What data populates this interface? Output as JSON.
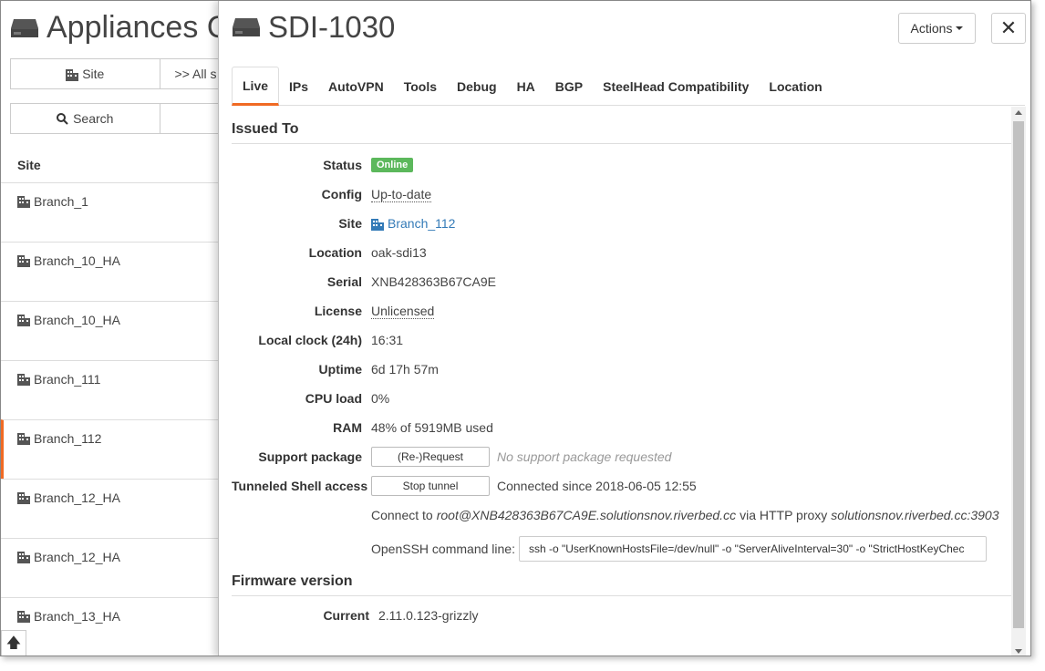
{
  "background": {
    "title": "Appliances C",
    "filter": {
      "site_button": "Site",
      "all_sites": ">> All s"
    },
    "search_button": "Search",
    "column_header": "Site",
    "sites": [
      "Branch_1",
      "Branch_10_HA",
      "Branch_10_HA",
      "Branch_111",
      "Branch_112",
      "Branch_12_HA",
      "Branch_12_HA",
      "Branch_13_HA"
    ],
    "active_site_index": 4
  },
  "panel": {
    "title": "SDI-1030",
    "actions_label": "Actions",
    "close_label": "✕",
    "tabs": [
      "Live",
      "IPs",
      "AutoVPN",
      "Tools",
      "Debug",
      "HA",
      "BGP",
      "SteelHead Compatibility",
      "Location"
    ],
    "active_tab": "Live",
    "issued_to": {
      "heading": "Issued To",
      "status_label": "Status",
      "status_value": "Online",
      "config_label": "Config",
      "config_value": "Up-to-date",
      "site_label": "Site",
      "site_value": "Branch_112",
      "location_label": "Location",
      "location_value": "oak-sdi13",
      "serial_label": "Serial",
      "serial_value": "XNB428363B67CA9E",
      "license_label": "License",
      "license_value": "Unlicensed",
      "clock_label": "Local clock (24h)",
      "clock_value": "16:31",
      "uptime_label": "Uptime",
      "uptime_value": "6d 17h 57m",
      "cpu_label": "CPU load",
      "cpu_value": "0%",
      "ram_label": "RAM",
      "ram_value": "48% of 5919MB used",
      "support_label": "Support package",
      "support_button": "(Re-)Request",
      "support_status": "No support package requested",
      "shell_label": "Tunneled Shell access",
      "shell_button": "Stop tunnel",
      "shell_status": "Connected since 2018-06-05 12:55",
      "connect_prefix": "Connect to",
      "connect_host": "root@XNB428363B67CA9E.solutionsnov.riverbed.cc",
      "connect_via": "via HTTP proxy",
      "connect_proxy": "solutionsnov.riverbed.cc:3903",
      "openssh_label": "OpenSSH command line:",
      "openssh_value": "ssh -o \"UserKnownHostsFile=/dev/null\" -o \"ServerAliveInterval=30\" -o \"StrictHostKeyChec"
    },
    "firmware": {
      "heading": "Firmware version",
      "current_label": "Current",
      "current_value": "2.11.0.123-grizzly"
    }
  },
  "colors": {
    "accent": "#f06a23",
    "online": "#5cb85c",
    "link": "#337ab7"
  },
  "icons": {
    "device": "hard-drive-icon",
    "site": "building-icon",
    "search": "search-icon",
    "scroll_top": "arrow-up-icon"
  }
}
